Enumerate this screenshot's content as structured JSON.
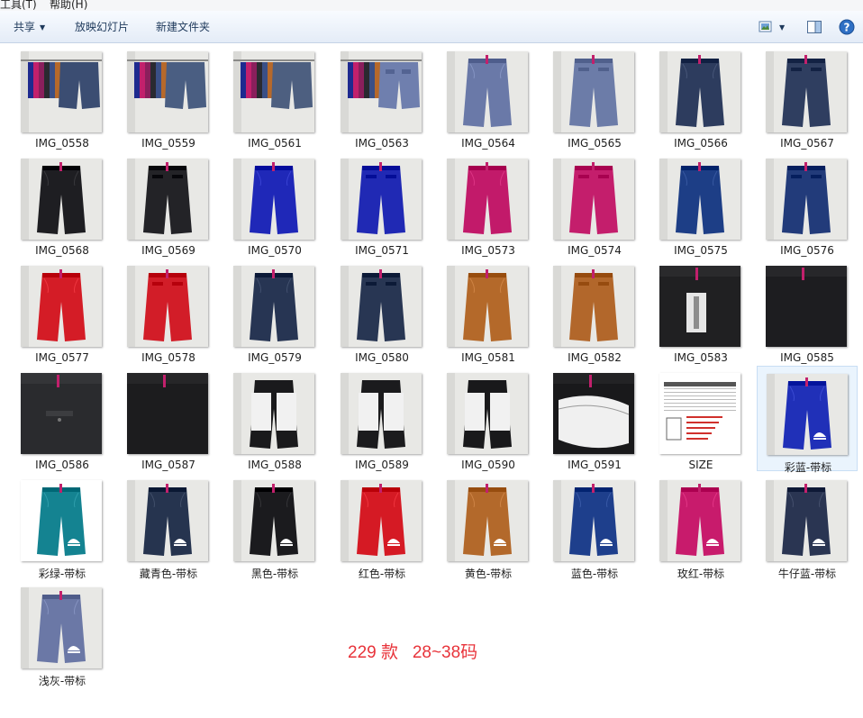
{
  "menu": {
    "items": [
      "工具(T)",
      "帮助(H)"
    ]
  },
  "toolbar": {
    "share_label": "共享",
    "slideshow_label": "放映幻灯片",
    "new_folder_label": "新建文件夹",
    "view_icon": "view-options-icon",
    "preview_pane_icon": "preview-pane-icon",
    "help_icon": "help-icon"
  },
  "items": [
    {
      "name": "IMG_0558",
      "kind": "rack",
      "color": "#3b4d72"
    },
    {
      "name": "IMG_0559",
      "kind": "rack",
      "color": "#4a5e82"
    },
    {
      "name": "IMG_0561",
      "kind": "rack",
      "color": "#4d5f80"
    },
    {
      "name": "IMG_0563",
      "kind": "rack-back",
      "color": "#6f7fae"
    },
    {
      "name": "IMG_0564",
      "kind": "front",
      "color": "#6a79a8"
    },
    {
      "name": "IMG_0565",
      "kind": "back",
      "color": "#6c7ca8"
    },
    {
      "name": "IMG_0566",
      "kind": "front",
      "color": "#2d3c5e"
    },
    {
      "name": "IMG_0567",
      "kind": "back",
      "color": "#2f3e60"
    },
    {
      "name": "IMG_0568",
      "kind": "front",
      "color": "#1e1e22"
    },
    {
      "name": "IMG_0569",
      "kind": "back",
      "color": "#232327"
    },
    {
      "name": "IMG_0570",
      "kind": "front",
      "color": "#1f28b8"
    },
    {
      "name": "IMG_0571",
      "kind": "back",
      "color": "#2029b4"
    },
    {
      "name": "IMG_0573",
      "kind": "front",
      "color": "#c21a6a"
    },
    {
      "name": "IMG_0574",
      "kind": "back",
      "color": "#c41e6c"
    },
    {
      "name": "IMG_0575",
      "kind": "front",
      "color": "#1d3e86"
    },
    {
      "name": "IMG_0576",
      "kind": "back",
      "color": "#223b7a"
    },
    {
      "name": "IMG_0577",
      "kind": "front",
      "color": "#d41c26"
    },
    {
      "name": "IMG_0578",
      "kind": "back",
      "color": "#d21d28"
    },
    {
      "name": "IMG_0579",
      "kind": "front",
      "color": "#273553"
    },
    {
      "name": "IMG_0580",
      "kind": "back",
      "color": "#283653"
    },
    {
      "name": "IMG_0581",
      "kind": "front",
      "color": "#b4692a"
    },
    {
      "name": "IMG_0582",
      "kind": "back",
      "color": "#b2672b"
    },
    {
      "name": "IMG_0583",
      "kind": "zip",
      "color": "#202022"
    },
    {
      "name": "IMG_0585",
      "kind": "close",
      "color": "#1d1d20"
    },
    {
      "name": "IMG_0586",
      "kind": "close-pocket",
      "color": "#2a2b2e"
    },
    {
      "name": "IMG_0587",
      "kind": "close",
      "color": "#1c1c1e"
    },
    {
      "name": "IMG_0588",
      "kind": "inside",
      "color": "#1a1a1c"
    },
    {
      "name": "IMG_0589",
      "kind": "inside",
      "color": "#1b1b1d"
    },
    {
      "name": "IMG_0590",
      "kind": "inside",
      "color": "#19191b"
    },
    {
      "name": "IMG_0591",
      "kind": "inside-close",
      "color": "#19191b"
    },
    {
      "name": "SIZE",
      "kind": "size",
      "color": "#f4f4f4"
    },
    {
      "name": "彩蓝-带标",
      "kind": "logo",
      "color": "#2030b8"
    },
    {
      "name": "彩绿-带标",
      "kind": "logo-white",
      "color": "#148391"
    },
    {
      "name": "藏青色-带标",
      "kind": "logo",
      "color": "#26344f"
    },
    {
      "name": "黑色-带标",
      "kind": "logo",
      "color": "#1b1b1e"
    },
    {
      "name": "红色-带标",
      "kind": "logo",
      "color": "#d51a24"
    },
    {
      "name": "黄色-带标",
      "kind": "logo",
      "color": "#b3692b"
    },
    {
      "name": "蓝色-带标",
      "kind": "logo",
      "color": "#1e3f8c"
    },
    {
      "name": "玫红-带标",
      "kind": "logo",
      "color": "#c81b6c"
    },
    {
      "name": "牛仔蓝-带标",
      "kind": "logo",
      "color": "#2a3552"
    },
    {
      "name": "浅灰-带标",
      "kind": "logo",
      "color": "#6b78a6"
    }
  ],
  "selected_item": "彩蓝-带标",
  "note": "229 款   28~38码",
  "colors": {
    "note": "#e8333a",
    "toolbar_text": "#1e395b",
    "selection": "#eaf4fd"
  }
}
